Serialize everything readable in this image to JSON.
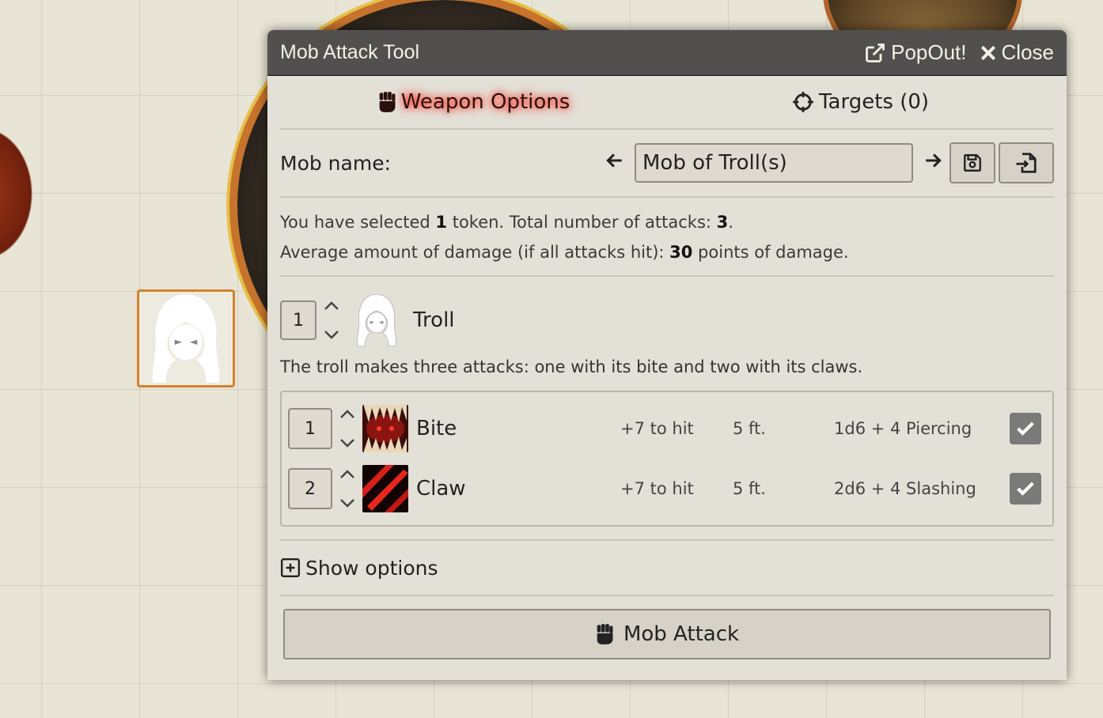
{
  "window": {
    "title": "Mob Attack Tool",
    "popout_label": "PopOut!",
    "close_label": "Close"
  },
  "tabs": [
    {
      "label": "Weapon Options",
      "icon": "fist-icon",
      "active": true
    },
    {
      "label": "Targets (0)",
      "icon": "crosshair-icon",
      "active": false
    }
  ],
  "mob_name": {
    "label": "Mob name:",
    "value": "Mob of Troll(s)"
  },
  "summary": {
    "line1_prefix": "You have selected ",
    "selected_count": "1",
    "line1_mid": " token. Total number of attacks: ",
    "total_attacks": "3",
    "line1_suffix": ".",
    "line2_prefix": "Average amount of damage (if all attacks hit): ",
    "avg_damage": "30",
    "line2_suffix": " points of damage."
  },
  "monster": {
    "count": "1",
    "name": "Troll",
    "description": "The troll makes three attacks: one with its bite and two with its claws."
  },
  "weapons": [
    {
      "count": "1",
      "name": "Bite",
      "to_hit": "+7 to hit",
      "reach": "5 ft.",
      "damage": "1d6 + 4 Piercing",
      "checked": true
    },
    {
      "count": "2",
      "name": "Claw",
      "to_hit": "+7 to hit",
      "reach": "5 ft.",
      "damage": "2d6 + 4 Slashing",
      "checked": true
    }
  ],
  "show_options_label": "Show options",
  "mob_attack_label": "Mob Attack"
}
